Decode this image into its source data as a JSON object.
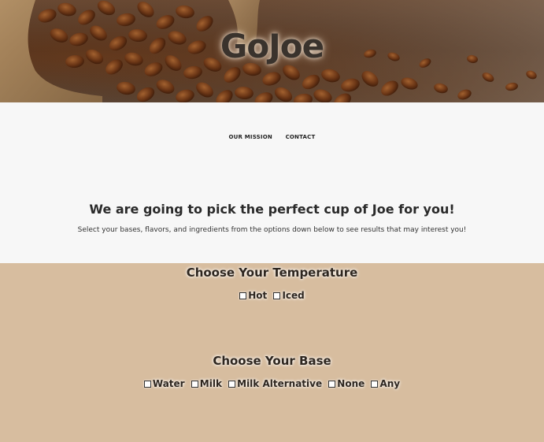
{
  "hero": {
    "title": "GoJoe"
  },
  "nav": {
    "items": [
      {
        "label": "OUR MISSION"
      },
      {
        "label": "CONTACT"
      }
    ]
  },
  "intro": {
    "heading": "We are going to pick the perfect cup of Joe for you!",
    "subtext": "Select your bases, flavors, and ingredients from the options down below to see results that may interest you!"
  },
  "temperature": {
    "heading": "Choose Your Temperature",
    "options": [
      {
        "label": "Hot"
      },
      {
        "label": "Iced"
      }
    ]
  },
  "base": {
    "heading": "Choose Your Base",
    "options": [
      {
        "label": "Water"
      },
      {
        "label": "Milk"
      },
      {
        "label": "Milk Alternative"
      },
      {
        "label": "None"
      },
      {
        "label": "Any"
      }
    ]
  },
  "colors": {
    "intro_bg": "#f7f7f7",
    "options_bg": "#d7bd9f",
    "text_dark": "#2e261f"
  }
}
